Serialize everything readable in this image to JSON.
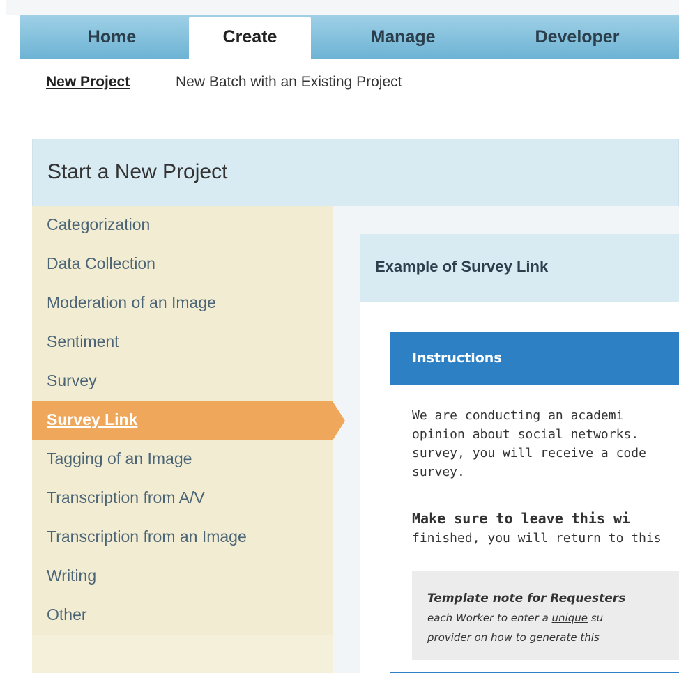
{
  "tabs": [
    {
      "label": "Home"
    },
    {
      "label": "Create"
    },
    {
      "label": "Manage"
    },
    {
      "label": "Developer"
    }
  ],
  "subnav": [
    {
      "label": "New Project"
    },
    {
      "label": "New Batch with an Existing Project"
    }
  ],
  "panel": {
    "title": "Start a New Project"
  },
  "sidebar": {
    "items": [
      {
        "label": "Categorization"
      },
      {
        "label": "Data Collection"
      },
      {
        "label": "Moderation of an Image"
      },
      {
        "label": "Sentiment"
      },
      {
        "label": "Survey"
      },
      {
        "label": "Survey Link"
      },
      {
        "label": "Tagging of an Image"
      },
      {
        "label": "Transcription from A/V"
      },
      {
        "label": "Transcription from an Image"
      },
      {
        "label": "Writing"
      },
      {
        "label": "Other"
      }
    ],
    "selected": "Survey Link"
  },
  "example": {
    "title": "Example of Survey Link",
    "instructions_title": "Instructions",
    "body_lines": [
      "We are conducting an academi",
      "opinion about social networks.",
      "survey, you will receive a code",
      "survey."
    ],
    "p2_bold": "Make sure to leave this wi",
    "p2_line": "finished, you will return to this",
    "note_bold": "Template note for Requesters",
    "note_line1_pre": "each Worker to enter a ",
    "note_line1_u": "unique",
    "note_line1_post": " su",
    "note_line2": "provider on how to generate this"
  },
  "colors": {
    "tab_bar": "#6db3d4",
    "panel_header": "#d8ebf3",
    "sidebar_bg": "#f1ecd2",
    "selected_item": "#eea75b",
    "instructions_header": "#2e80c4"
  }
}
